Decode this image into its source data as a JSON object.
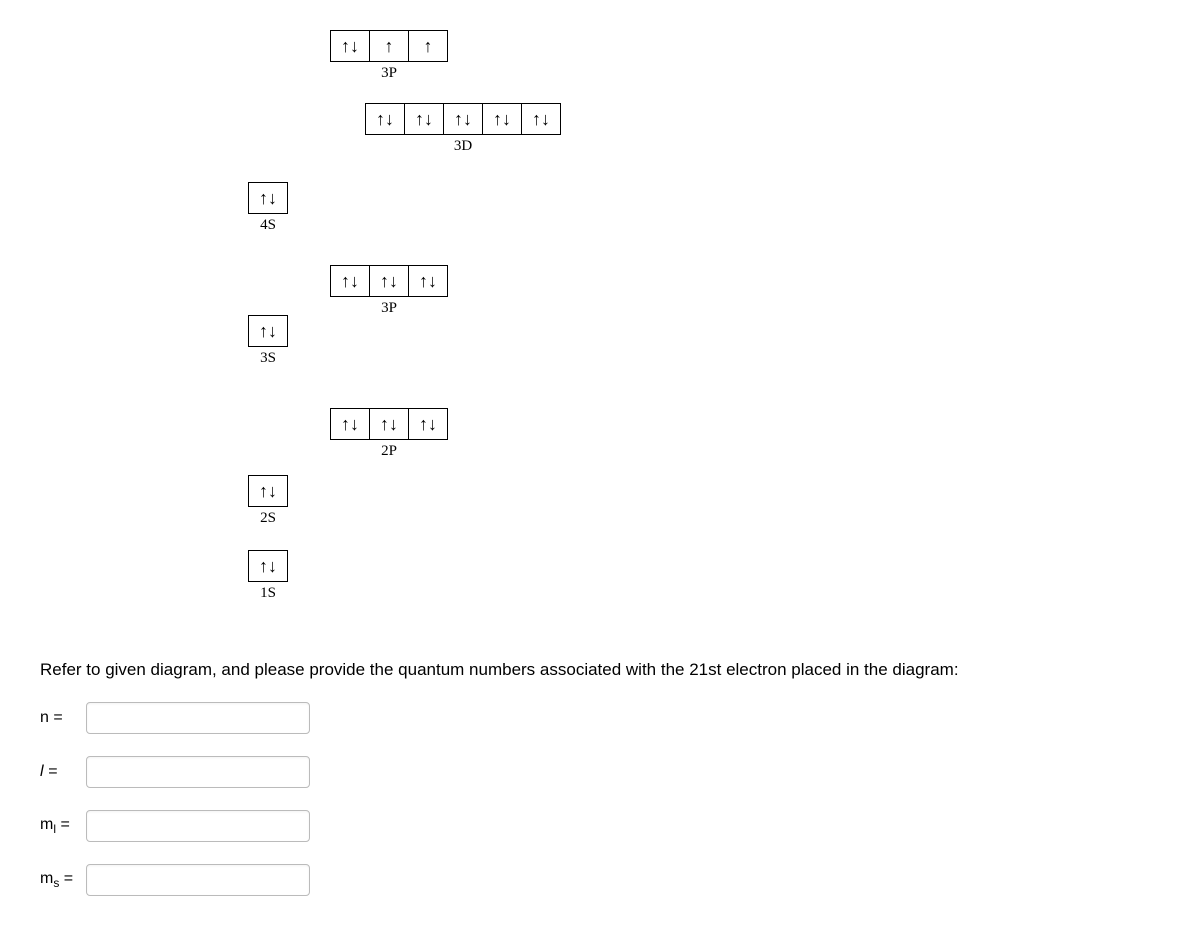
{
  "diagram": {
    "orbitals": {
      "top_3p": {
        "label": "3P",
        "boxes": [
          "pair",
          "up",
          "up"
        ]
      },
      "d_3d": {
        "label": "3D",
        "boxes": [
          "pair",
          "pair",
          "pair",
          "pair",
          "pair"
        ]
      },
      "s_4s": {
        "label": "4S",
        "boxes": [
          "pair"
        ]
      },
      "mid_3p": {
        "label": "3P",
        "boxes": [
          "pair",
          "pair",
          "pair"
        ]
      },
      "s_3s": {
        "label": "3S",
        "boxes": [
          "pair"
        ]
      },
      "p_2p": {
        "label": "2P",
        "boxes": [
          "pair",
          "pair",
          "pair"
        ]
      },
      "s_2s": {
        "label": "2S",
        "boxes": [
          "pair"
        ]
      },
      "s_1s": {
        "label": "1S",
        "boxes": [
          "pair"
        ]
      }
    }
  },
  "question_text": "Refer to given diagram, and please provide the quantum numbers associated with the 21st electron placed in the diagram:",
  "inputs": {
    "n_label": "n =",
    "l_label_html": "l =",
    "ml_label_html": "m<sub>l</sub> =",
    "ms_label_html": "m<sub>s</sub> ="
  }
}
